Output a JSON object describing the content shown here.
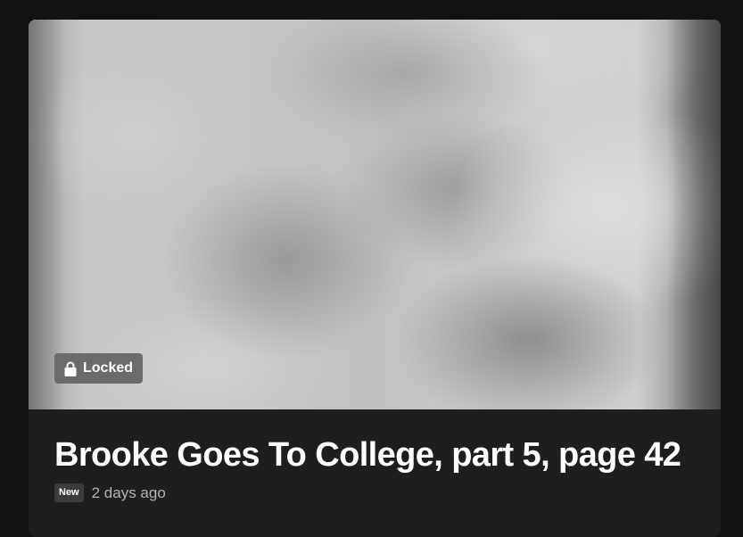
{
  "post": {
    "title": "Brooke Goes To College, part 5, page 42",
    "locked_label": "Locked",
    "locked_icon": "lock-icon",
    "new_badge": "New",
    "time_ago": "2 days ago"
  },
  "colors": {
    "page_background": "#121212",
    "card_background": "#1e1e1e",
    "locked_badge_background": "#6b6b6b",
    "new_badge_background": "#3c3c3c",
    "title_color": "#ffffff",
    "meta_color": "#b4b4b4"
  }
}
